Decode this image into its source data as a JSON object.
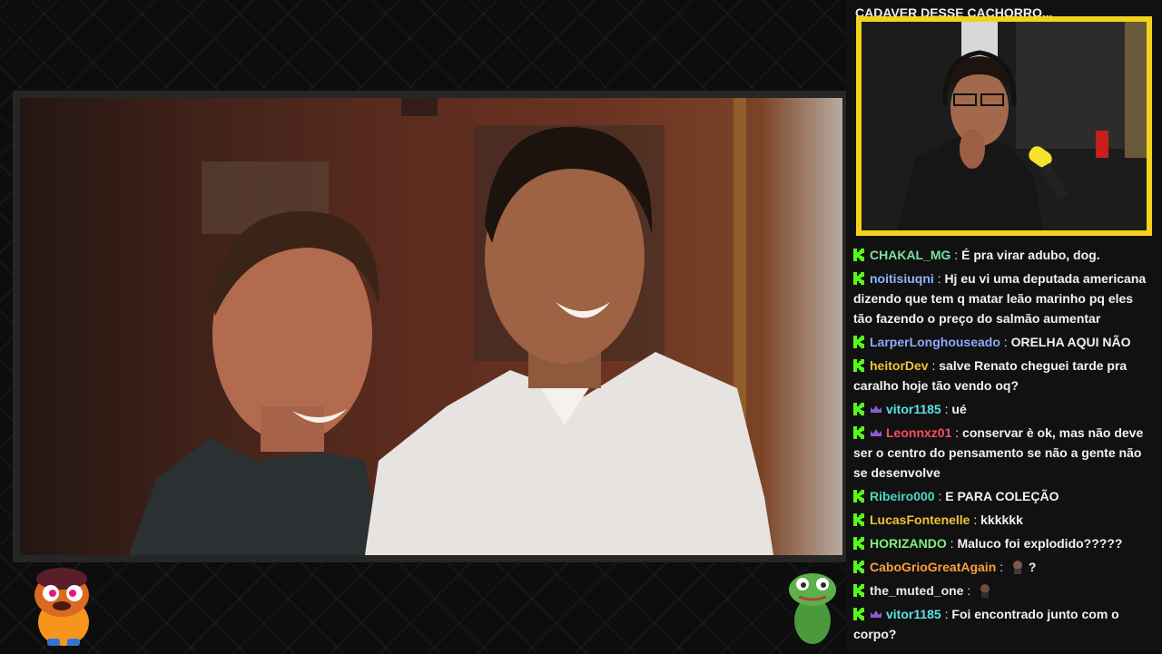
{
  "chat": {
    "header_text": "CADAVER DESSE CACHORRO...",
    "messages": [
      {
        "user": "CHAKAL_MG",
        "user_color": "#7be0a0",
        "text": "É pra virar adubo, dog.",
        "badges": [
          "kick"
        ]
      },
      {
        "user": "noitisiuqni",
        "user_color": "#8db5ff",
        "text": "Hj eu vi uma deputada americana dizendo que tem q matar leão marinho pq eles tão fazendo o preço do salmão aumentar",
        "badges": [
          "kick"
        ]
      },
      {
        "user": "LarperLonghouseado",
        "user_color": "#8fa8ff",
        "text": "ORELHA AQUI NÃO",
        "badges": [
          "kick"
        ]
      },
      {
        "user": "heitorDev",
        "user_color": "#f2c13c",
        "text": "salve Renato cheguei tarde pra caralho hoje tão vendo oq?",
        "badges": [
          "kick"
        ]
      },
      {
        "user": "vitor1185",
        "user_color": "#5ce1e6",
        "text": "ué",
        "badges": [
          "kick",
          "sub"
        ]
      },
      {
        "user": "Leonnxz01",
        "user_color": "#ff4d5a",
        "text": "conservar è ok, mas não deve ser o centro do pensamento se não a gente não se desenvolve",
        "badges": [
          "kick",
          "sub"
        ]
      },
      {
        "user": "Ribeiro000",
        "user_color": "#4fd6c3",
        "text": "E PARA COLEÇÃO",
        "badges": [
          "kick"
        ]
      },
      {
        "user": "LucasFontenelle",
        "user_color": "#f0c23b",
        "text": "kkkkkk",
        "badges": [
          "kick"
        ]
      },
      {
        "user": "HORIZANDO",
        "user_color": "#7ef07a",
        "text": "Maluco foi explodido?????",
        "badges": [
          "kick"
        ]
      },
      {
        "user": "CaboGrioGreatAgain",
        "user_color": "#ff9f3a",
        "text": "?",
        "badges": [
          "kick"
        ],
        "emote_before_text": true
      },
      {
        "user": "the_muted_one",
        "user_color": "#e8e8e8",
        "text": "",
        "badges": [
          "kick"
        ],
        "emote_before_text": true
      },
      {
        "user": "vitor1185",
        "user_color": "#5ce1e6",
        "text": "Foi encontrado junto com o corpo?",
        "badges": [
          "kick",
          "sub"
        ]
      }
    ]
  },
  "colors": {
    "kick_green": "#53fc18",
    "cam_border": "#f2d31b",
    "sub_badge": "#8a5cd1"
  },
  "icons": {
    "kick_badge": "kick-logo-icon",
    "sub_badge": "subscriber-crown-icon",
    "emote": "emote-icon"
  }
}
